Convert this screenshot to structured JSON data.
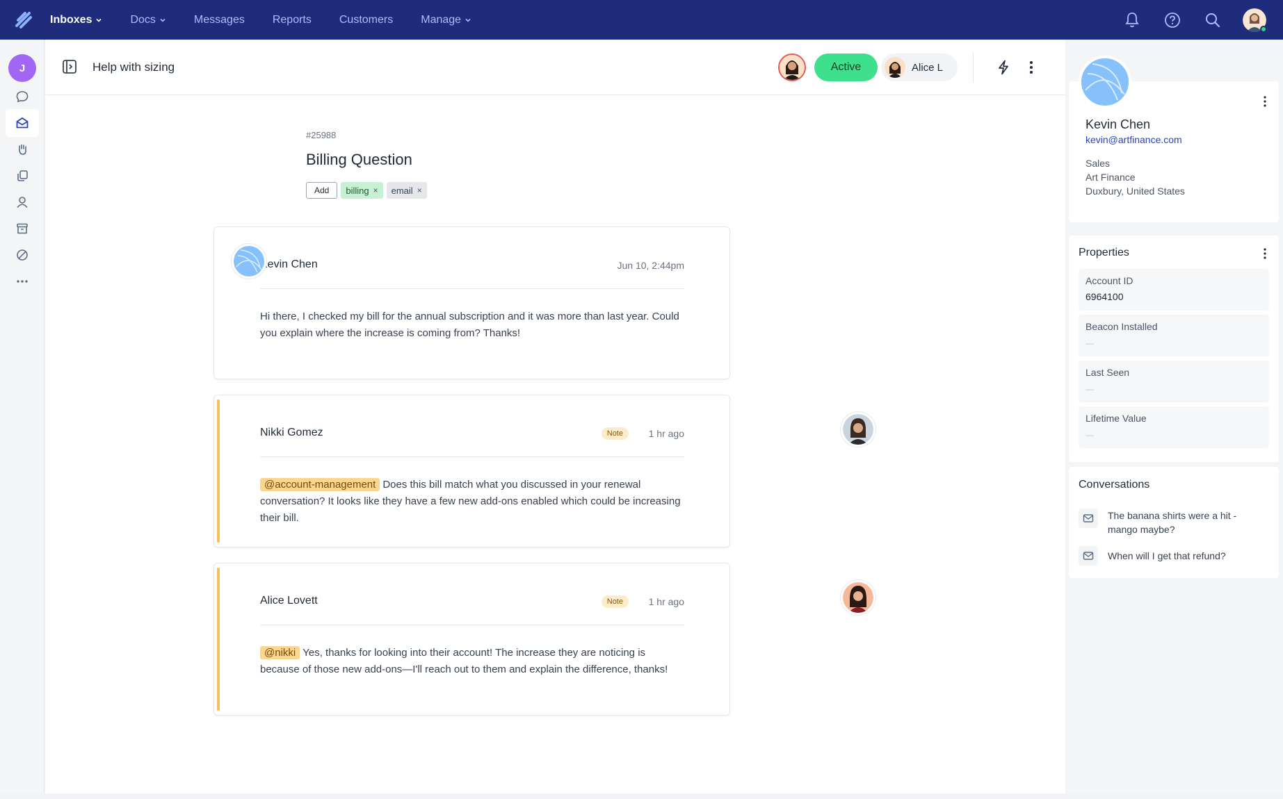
{
  "nav": {
    "items": [
      {
        "label": "Inboxes",
        "active": true,
        "dropdown": true
      },
      {
        "label": "Docs",
        "active": false,
        "dropdown": true
      },
      {
        "label": "Messages",
        "active": false,
        "dropdown": false
      },
      {
        "label": "Reports",
        "active": false,
        "dropdown": false
      },
      {
        "label": "Customers",
        "active": false,
        "dropdown": false
      },
      {
        "label": "Manage",
        "active": false,
        "dropdown": true
      }
    ],
    "colors": {
      "bar": "#1f2c7b",
      "item": "#aebcff",
      "active_item": "#ffffff",
      "online": "#35d27a"
    }
  },
  "rail": {
    "avatar_initial": "J",
    "avatar_color": "#a266f4",
    "icons": [
      "chat-icon",
      "inbox-icon",
      "hand-icon",
      "docs-icon",
      "person-icon",
      "archive-icon",
      "blocked-icon",
      "more-icon"
    ],
    "active_icon": "inbox-icon"
  },
  "conversation": {
    "header_title": "Help with sizing",
    "status": "Active",
    "status_color": "#3fe08d",
    "assignee": "Alice L",
    "number": "#25988",
    "subject": "Billing Question",
    "add_tag_label": "Add",
    "tags": [
      {
        "label": "billing",
        "color": "#c8f0d5"
      },
      {
        "label": "email",
        "color": "#e5e7eb"
      }
    ],
    "remove_tag_glyph": "×",
    "threads": [
      {
        "type": "message",
        "author": "Kevin Chen",
        "time": "Jun 10, 2:44pm",
        "mention": "",
        "body": "Hi there, I checked my bill for the annual subscription and it was more than last year. Could you explain where the increase is coming from? Thanks!"
      },
      {
        "type": "note",
        "author": "Nikki Gomez",
        "badge": "Note",
        "time": "1 hr ago",
        "mention": "@account-management",
        "body": "Does this bill match what you discussed in your renewal conversation? It looks like they have a few new add-ons enabled which could be increasing their bill."
      },
      {
        "type": "note",
        "author": "Alice Lovett",
        "badge": "Note",
        "time": "1 hr ago",
        "mention": "@nikki",
        "body": "Yes, thanks for looking into their account! The increase they are noticing is because of those new add-ons—I'll reach out to them and explain the difference, thanks!"
      }
    ],
    "note_accent": "#f6c05a"
  },
  "customer": {
    "name": "Kevin Chen",
    "email": "kevin@artfinance.com",
    "title": "Sales",
    "company": "Art Finance",
    "location": "Duxbury, United States"
  },
  "properties": {
    "title": "Properties",
    "items": [
      {
        "label": "Account ID",
        "value": "6964100"
      },
      {
        "label": "Beacon Installed",
        "value": "—"
      },
      {
        "label": "Last Seen",
        "value": "—"
      },
      {
        "label": "Lifetime Value",
        "value": "—"
      }
    ]
  },
  "conversations": {
    "title": "Conversations",
    "items": [
      {
        "subject": "The banana shirts were a hit - mango maybe?"
      },
      {
        "subject": "When will I get that refund?"
      }
    ]
  }
}
